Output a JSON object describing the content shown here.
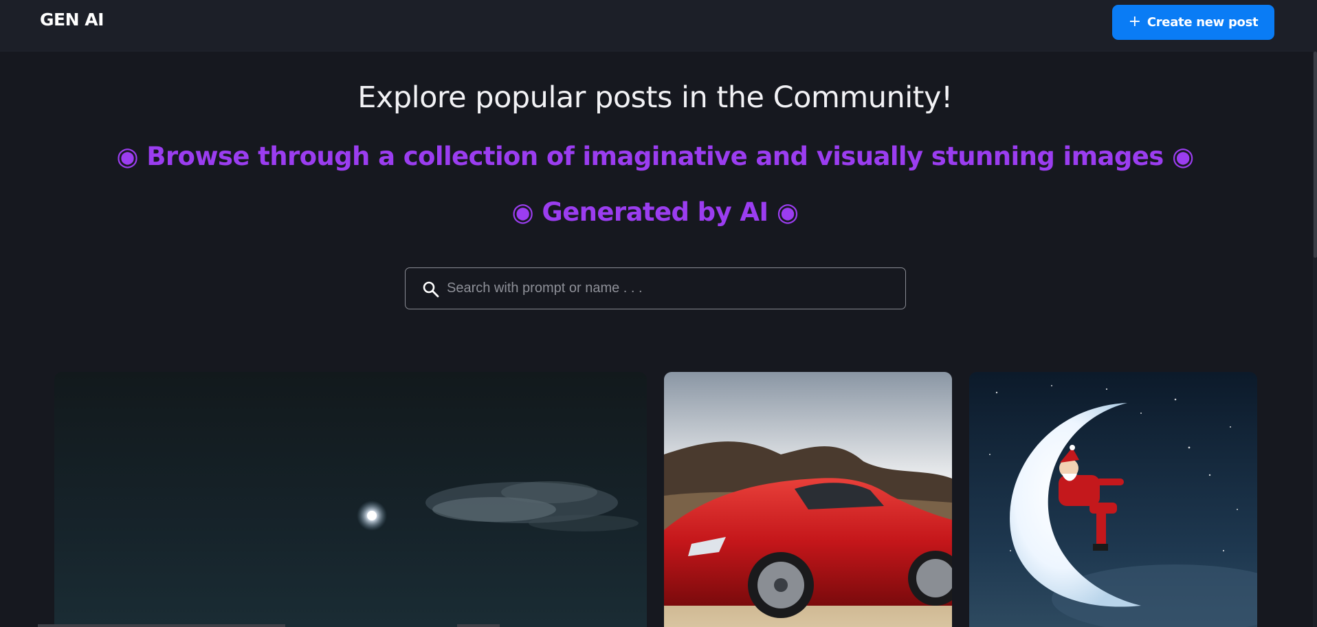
{
  "header": {
    "logo": "GEN AI",
    "create_button_label": "Create new post",
    "create_button_icon": "plus-icon"
  },
  "hero": {
    "title": "Explore popular posts in the Community!",
    "subtitle_1": "◉ Browse through a collection of imaginative and visually stunning images ◉",
    "subtitle_2": "◉ Generated by AI ◉"
  },
  "search": {
    "placeholder": "Search with prompt or name . . .",
    "value": "",
    "icon": "search-icon"
  },
  "gallery": {
    "cards": [
      {
        "image": "night-sky-moon-clouds"
      },
      {
        "image": "red-sports-car-desert"
      },
      {
        "image": "santa-on-crescent-moon"
      }
    ]
  },
  "colors": {
    "background": "#16181f",
    "header": "#1c1f28",
    "accent_button": "#0a7cf5",
    "subtitle": "#9b3df0",
    "title_text": "#f2f2f5"
  }
}
